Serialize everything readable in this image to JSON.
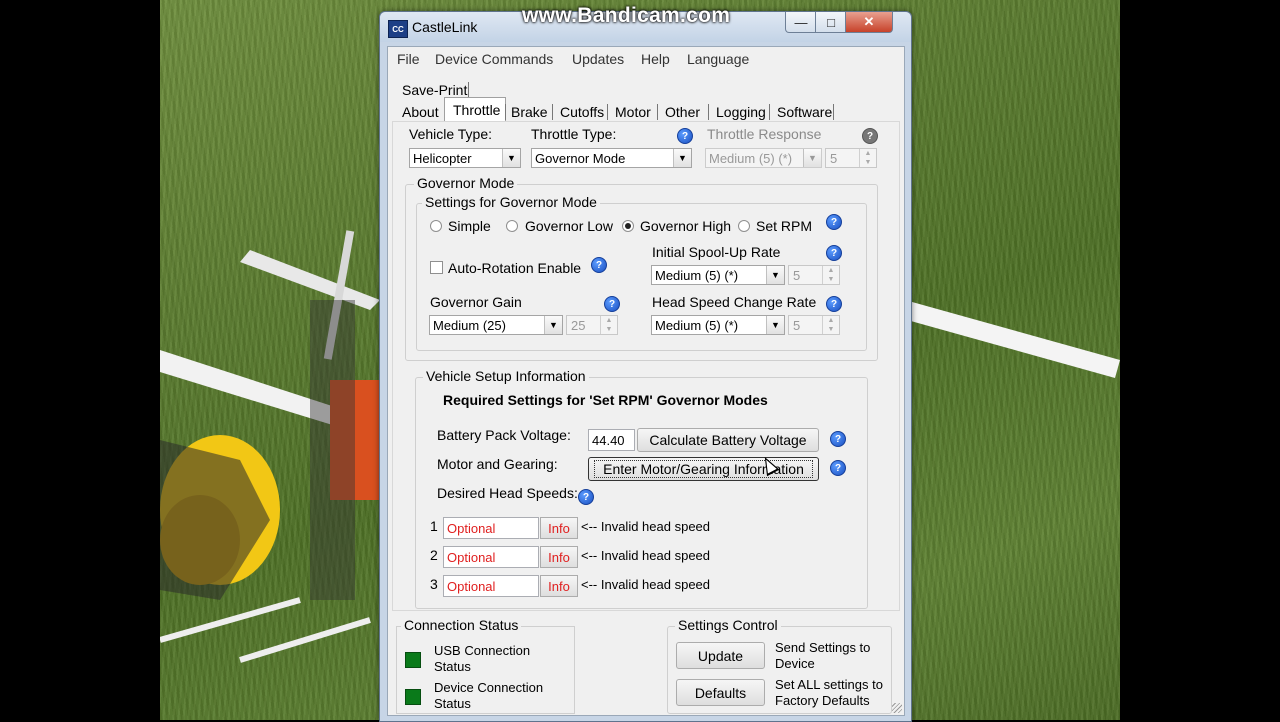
{
  "watermark": "www.Bandicam.com",
  "window": {
    "title": "CastleLink",
    "icon_text": "CC"
  },
  "menu": [
    "File",
    "Device Commands",
    "Updates",
    "Help",
    "Language"
  ],
  "tabs_row1": [
    "Save-Print"
  ],
  "tabs_row2": [
    "About",
    "Throttle",
    "Brake",
    "Cutoffs",
    "Motor",
    "Other",
    "Logging",
    "Software"
  ],
  "top": {
    "vehicle_type_label": "Vehicle Type:",
    "vehicle_type_value": "Helicopter",
    "throttle_type_label": "Throttle Type:",
    "throttle_type_value": "Governor Mode",
    "throttle_response_label": "Throttle Response",
    "throttle_response_value": "Medium (5) (*)",
    "throttle_response_num": "5"
  },
  "governor": {
    "group_title": "Governor Mode",
    "settings_title": "Settings for Governor Mode",
    "radios": [
      "Simple",
      "Governor Low",
      "Governor High",
      "Set RPM"
    ],
    "selected_radio": "Governor High",
    "auto_rotation_label": "Auto-Rotation Enable",
    "spool_label": "Initial Spool-Up Rate",
    "spool_value": "Medium (5) (*)",
    "spool_num": "5",
    "gain_label": "Governor Gain",
    "gain_value": "Medium (25)",
    "gain_num": "25",
    "head_speed_change_label": "Head Speed Change Rate",
    "head_speed_change_value": "Medium (5) (*)",
    "head_speed_change_num": "5"
  },
  "vehicle_setup": {
    "group_title": "Vehicle Setup Information",
    "heading": "Required Settings for 'Set RPM' Governor Modes",
    "battery_label": "Battery Pack Voltage:",
    "battery_value": "44.40",
    "calc_button": "Calculate Battery Voltage",
    "motor_label": "Motor and Gearing:",
    "motor_button": "Enter Motor/Gearing Information",
    "desired_label": "Desired Head Speeds:",
    "rows": [
      {
        "num": "1",
        "placeholder": "Optional",
        "info": "Info",
        "status": "<-- Invalid head speed"
      },
      {
        "num": "2",
        "placeholder": "Optional",
        "info": "Info",
        "status": "<-- Invalid head speed"
      },
      {
        "num": "3",
        "placeholder": "Optional",
        "info": "Info",
        "status": "<-- Invalid head speed"
      }
    ]
  },
  "connection": {
    "title": "Connection Status",
    "usb": "USB Connection Status",
    "device": "Device Connection Status",
    "led_color": "#0a7a1a"
  },
  "settings_control": {
    "title": "Settings Control",
    "update_button": "Update",
    "update_desc": "Send Settings to Device",
    "defaults_button": "Defaults",
    "defaults_desc": "Set ALL settings to Factory Defaults"
  }
}
